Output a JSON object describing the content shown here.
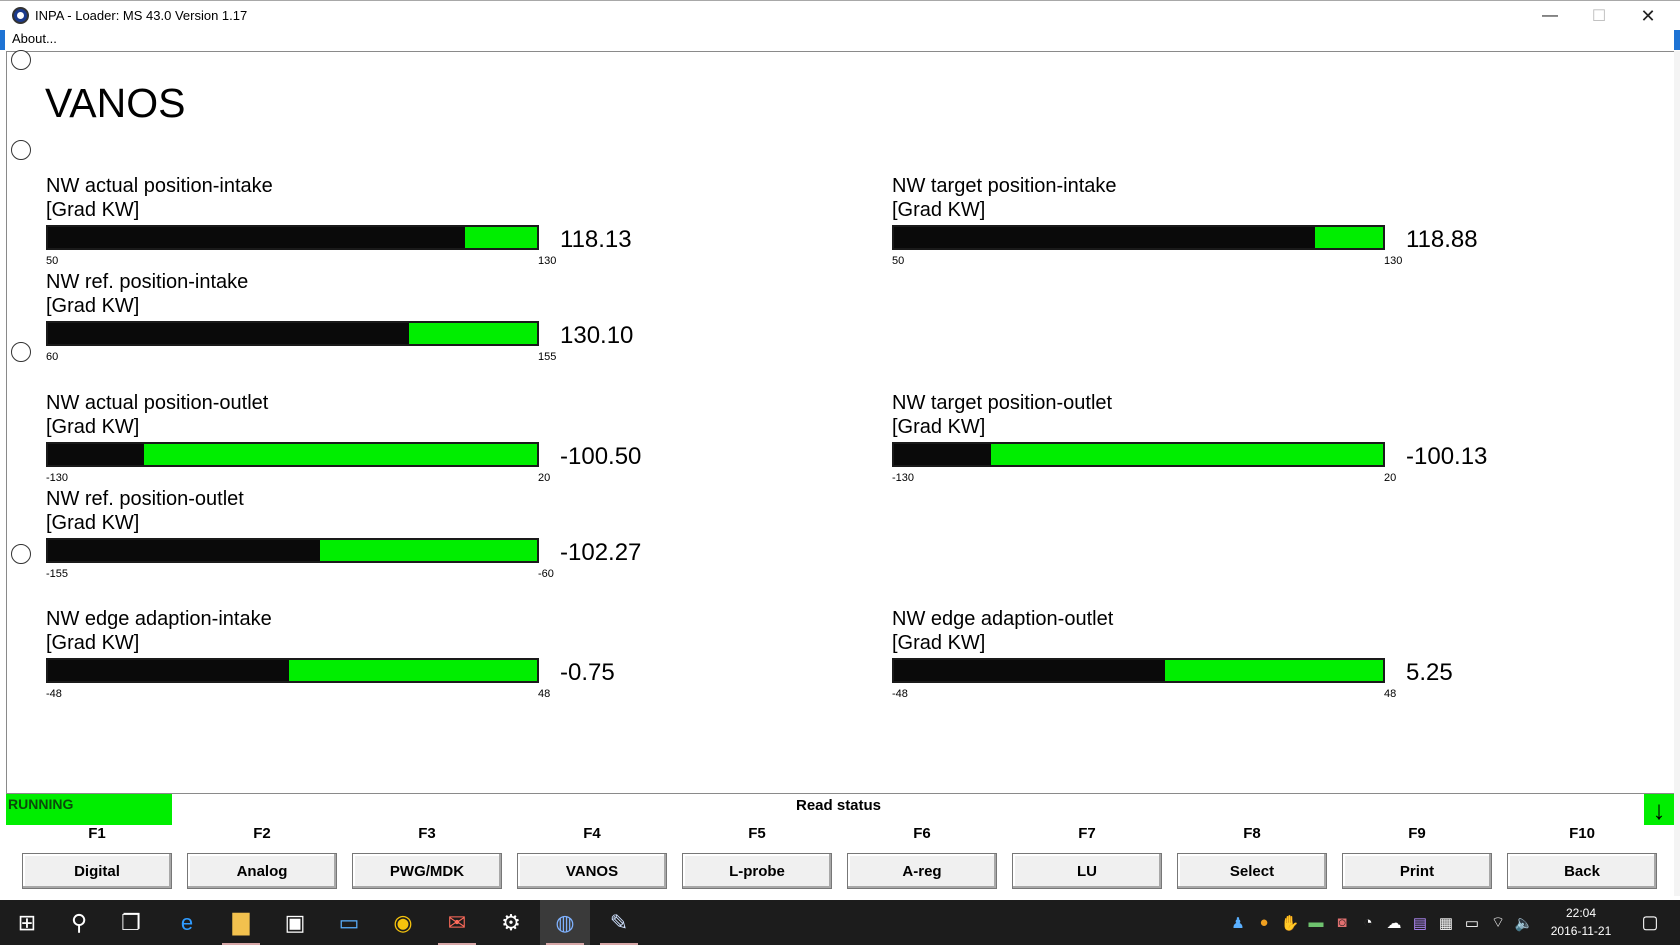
{
  "window": {
    "title": "INPA - Loader:  MS 43.0 Version 1.17",
    "minimize_glyph": "—",
    "maximize_glyph": "☐",
    "close_glyph": "✕"
  },
  "menu": {
    "about": "About..."
  },
  "page": {
    "title": "VANOS"
  },
  "meters": {
    "actual_intake": {
      "name": "NW actual position-intake",
      "unit": "[Grad KW]",
      "min": "50",
      "max": "130",
      "value": "118.13",
      "level": 0.853
    },
    "target_intake": {
      "name": "NW target position-intake",
      "unit": "[Grad KW]",
      "min": "50",
      "max": "130",
      "value": "118.88",
      "level": 0.861
    },
    "ref_intake": {
      "name": "NW ref. position-intake",
      "unit": "[Grad KW]",
      "min": "60",
      "max": "155",
      "value": "130.10",
      "level": 0.738
    },
    "actual_outlet": {
      "name": "NW actual position-outlet",
      "unit": "[Grad KW]",
      "min": "-130",
      "max": "20",
      "value": "-100.50",
      "level": 0.197
    },
    "target_outlet": {
      "name": "NW target position-outlet",
      "unit": "[Grad KW]",
      "min": "-130",
      "max": "20",
      "value": "-100.13",
      "level": 0.199
    },
    "ref_outlet": {
      "name": "NW ref. position-outlet",
      "unit": "[Grad KW]",
      "min": "-155",
      "max": "-60",
      "value": "-102.27",
      "level": 0.557
    },
    "edge_intake": {
      "name": "NW edge adaption-intake",
      "unit": "[Grad KW]",
      "min": "-48",
      "max": "48",
      "value": "-0.75",
      "level": 0.492
    },
    "edge_outlet": {
      "name": "NW edge adaption-outlet",
      "unit": "[Grad KW]",
      "min": "-48",
      "max": "48",
      "value": "5.25",
      "level": 0.555
    }
  },
  "status": {
    "state": "RUNNING",
    "message": "Read status",
    "arrow_glyph": "↓"
  },
  "fkeys": [
    {
      "key": "F1",
      "label": "Digital"
    },
    {
      "key": "F2",
      "label": "Analog"
    },
    {
      "key": "F3",
      "label": "PWG/MDK"
    },
    {
      "key": "F4",
      "label": "VANOS"
    },
    {
      "key": "F5",
      "label": "L-probe"
    },
    {
      "key": "F6",
      "label": "A-reg"
    },
    {
      "key": "F7",
      "label": "LU"
    },
    {
      "key": "F8",
      "label": "Select"
    },
    {
      "key": "F9",
      "label": "Print"
    },
    {
      "key": "F10",
      "label": "Back"
    }
  ],
  "taskbar": {
    "icons": {
      "start": "⊞",
      "search": "⚲",
      "task_view": "❐",
      "edge": "e",
      "explorer": "▇",
      "store": "▣",
      "remote": "▭",
      "chrome": "◉",
      "mail": "✉",
      "settings": "⚙",
      "bmw": "◍",
      "paint": "✎"
    },
    "tray": {
      "person": "♟",
      "sun": "●",
      "hand": "✋",
      "chat": "▬",
      "camera": "◙",
      "wifi_alt": "◔",
      "cloud": "☁",
      "display": "▤",
      "box": "▦",
      "battery": "▭",
      "wifi": "⌔",
      "volume": "🔈"
    },
    "time": "22:04",
    "date": "2016-11-21",
    "notification_glyph": "▢"
  },
  "colors": {
    "bar_green": "#00ee00",
    "bar_black": "#0a0a0a",
    "running_green": "#00ee00",
    "taskbar": "#1c1c1c"
  }
}
